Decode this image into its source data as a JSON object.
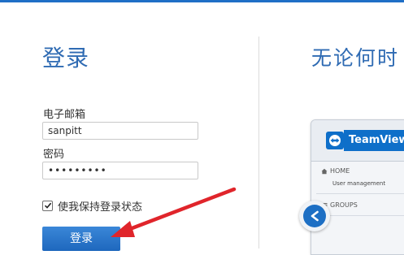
{
  "login": {
    "title": "登录",
    "email_label": "电子邮箱",
    "email_value": "sanpitt",
    "password_label": "密码",
    "password_value": "•••••••••",
    "remember_label": "使我保持登录状态",
    "remember_checked": true,
    "login_button": "登录"
  },
  "promo": {
    "title": "无论何时",
    "app": {
      "brand": "TeamViewer",
      "home_label": "HOME",
      "home_item": "User management",
      "groups_label": "GROUPS"
    }
  },
  "colors": {
    "accent": "#2f6bb3",
    "button": "#1e67bd",
    "annotation_arrow": "#e0252b"
  },
  "icons": {
    "checkbox": "checkmark-icon",
    "brand": "teamviewer-logo-icon",
    "home": "home-icon",
    "groups": "groups-icon",
    "back": "back-arrow-icon",
    "annotation": "red-arrow-annotation"
  }
}
